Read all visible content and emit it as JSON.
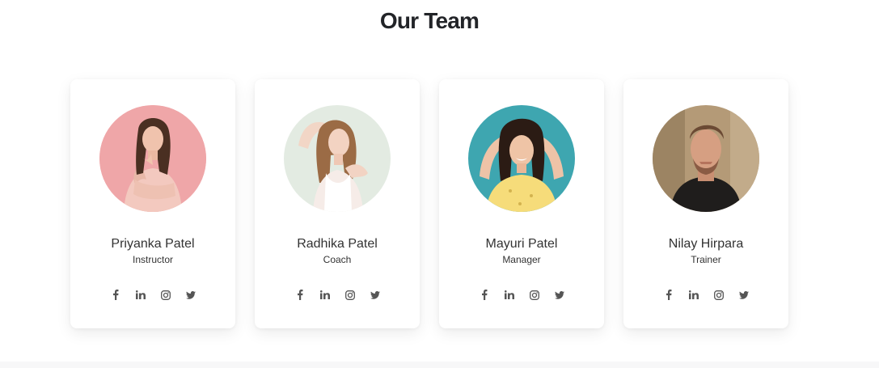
{
  "section": {
    "title": "Our Team"
  },
  "members": [
    {
      "name": "Priyanka Patel",
      "role": "Instructor",
      "avatar_bg": "#f1a7aa",
      "social": [
        "facebook-icon",
        "linkedin-icon",
        "instagram-icon",
        "twitter-icon"
      ]
    },
    {
      "name": "Radhika Patel",
      "role": "Coach",
      "avatar_bg": "#e3ebe2",
      "social": [
        "facebook-icon",
        "linkedin-icon",
        "instagram-icon",
        "twitter-icon"
      ]
    },
    {
      "name": "Mayuri Patel",
      "role": "Manager",
      "avatar_bg": "#3ea6b0",
      "social": [
        "facebook-icon",
        "linkedin-icon",
        "instagram-icon",
        "twitter-icon"
      ]
    },
    {
      "name": "Nilay Hirpara",
      "role": "Trainer",
      "avatar_bg": "#b49a77",
      "social": [
        "facebook-icon",
        "linkedin-icon",
        "instagram-icon",
        "twitter-icon"
      ]
    }
  ],
  "colors": {
    "title": "#222428",
    "text": "#333333",
    "icon": "#555555",
    "card_bg": "#ffffff"
  }
}
